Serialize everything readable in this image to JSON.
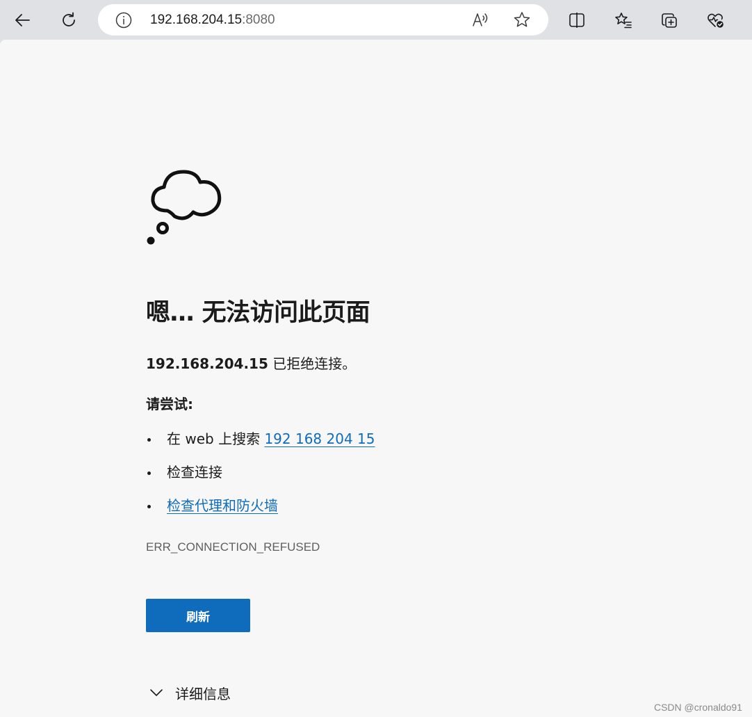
{
  "toolbar": {
    "back_icon": "back-arrow-icon",
    "refresh_icon": "refresh-icon",
    "address": {
      "host": "192.168.204.15",
      "port": ":8080"
    },
    "right_icons": [
      "split-screen-icon",
      "favorites-icon",
      "collections-icon",
      "browser-essentials-icon"
    ]
  },
  "error_page": {
    "title": "嗯… 无法访问此页面",
    "host_bold": "192.168.204.15",
    "refused_text": " 已拒绝连接。",
    "try_heading": "请尝试:",
    "suggestions": {
      "search_prefix": "在 web 上搜索 ",
      "search_link": "192 168 204 15",
      "check_connection": "检查连接",
      "check_proxy_link": "检查代理和防火墙"
    },
    "error_code": "ERR_CONNECTION_REFUSED",
    "refresh_button": "刷新",
    "details_label": "详细信息"
  },
  "watermark": "CSDN @cronaldo91",
  "colors": {
    "accent": "#0f6cbd",
    "page_bg": "#f7f7f7",
    "chrome_bg": "#dfe1e5"
  }
}
